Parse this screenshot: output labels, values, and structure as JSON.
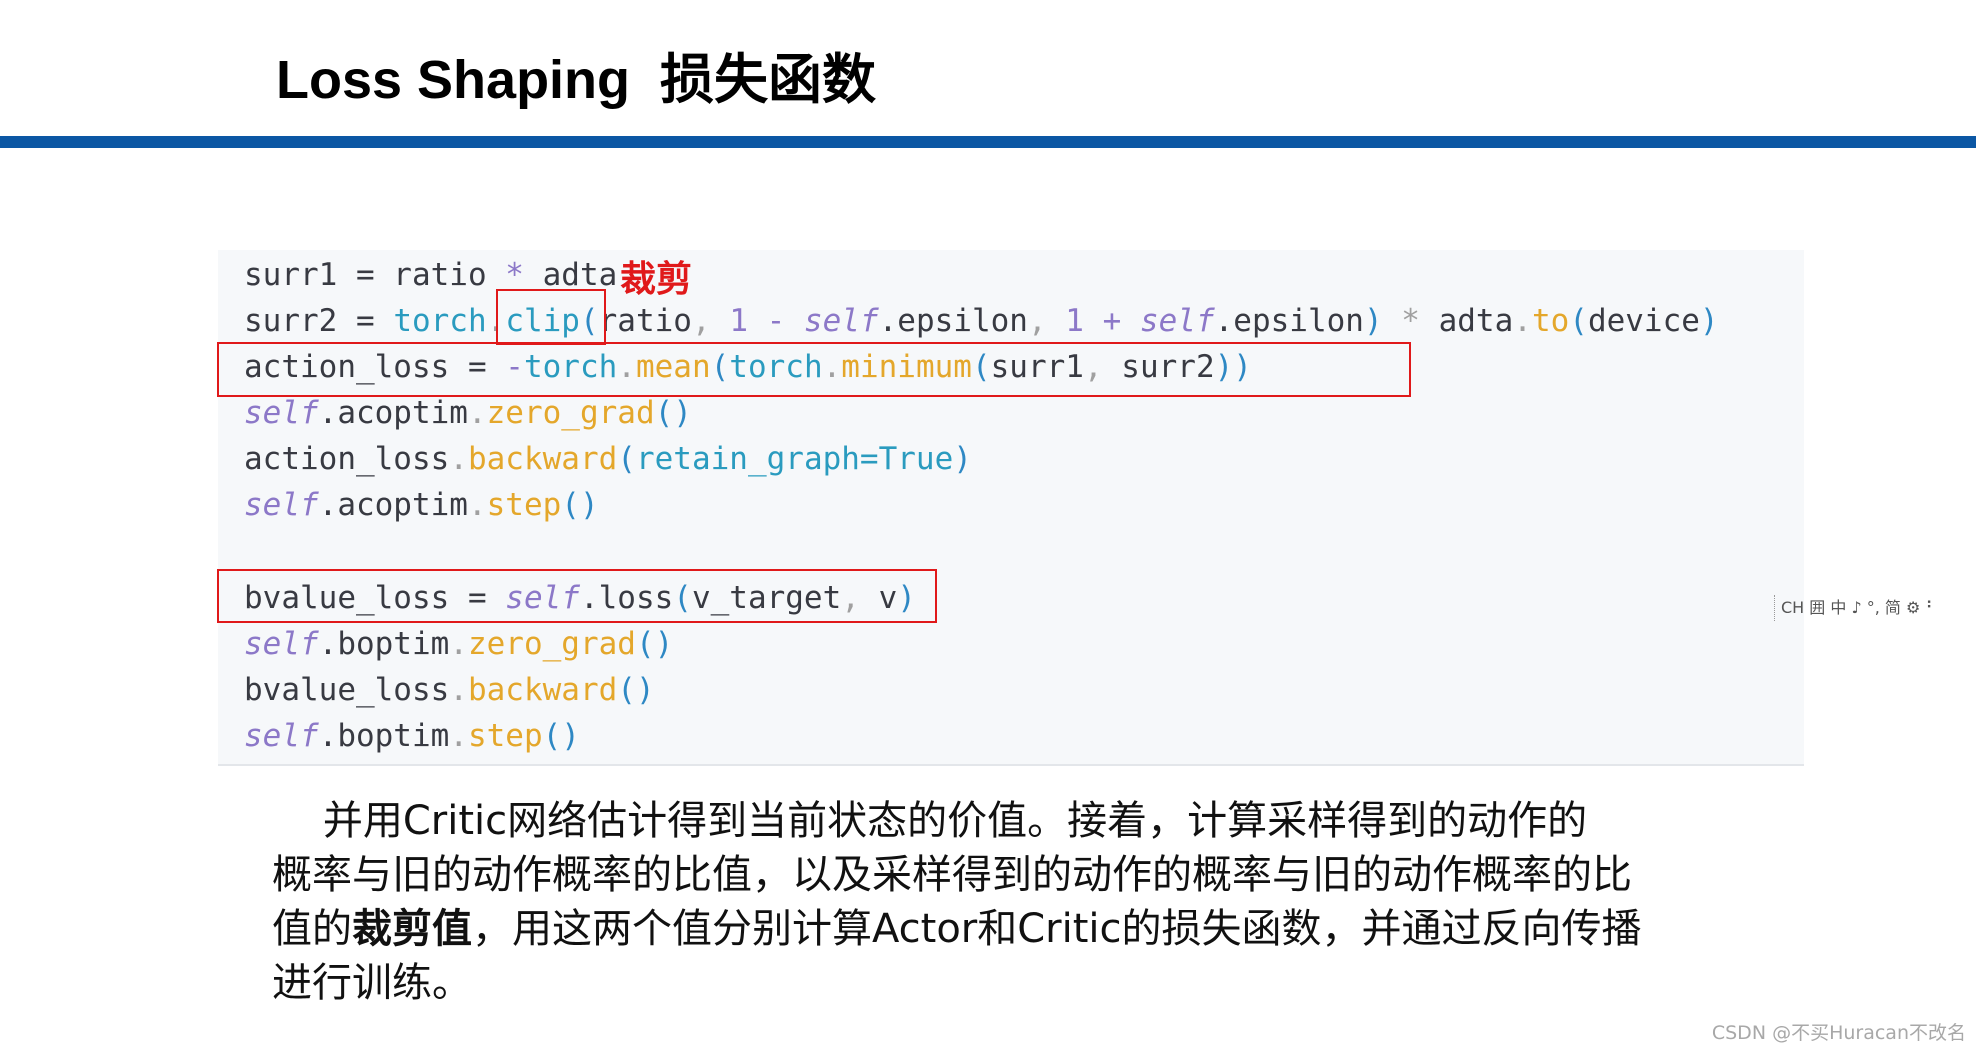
{
  "slide": {
    "title": "Loss Shaping  损失函数"
  },
  "code": {
    "line1": {
      "a": "surr1 = ratio ",
      "op": "*",
      "b": " adta"
    },
    "line2": {
      "a": "surr2 = ",
      "fn": "torch",
      "dot1": ".",
      "clip": "clip",
      "p1": "(",
      "b": "ratio",
      "c1": ",",
      "sp1": " ",
      "n1": "1",
      "op1": " - ",
      "self1": "self",
      "c": ".epsilon",
      "c2": ",",
      "sp2": " ",
      "n2": "1",
      "op2": " + ",
      "self2": "self",
      "d": ".epsilon",
      "p2": ")",
      "op3": " * ",
      "e": "adta",
      "dot2": ".",
      "to": "to",
      "p3": "(",
      "f": "device",
      "p4": ")"
    },
    "line3": {
      "a": "action_loss = ",
      "neg": "-",
      "fn1": "torch",
      "dot1": ".",
      "mean": "mean",
      "p1": "(",
      "fn2": "torch",
      "dot2": ".",
      "minimum": "minimum",
      "p2": "(",
      "b": "surr1",
      "c": ",",
      "d": " surr2",
      "p3": "))"
    },
    "line4": {
      "self": "self",
      "a": ".acoptim",
      "dot": ".",
      "m": "zero_grad",
      "p": "()"
    },
    "line5": {
      "a": "action_loss",
      "dot": ".",
      "m": "backward",
      "p1": "(",
      "b": "retain_graph=True",
      "p2": ")"
    },
    "line6": {
      "self": "self",
      "a": ".acoptim",
      "dot": ".",
      "m": "step",
      "p": "()"
    },
    "line7": {
      "a": "bvalue_loss = ",
      "self": "self",
      "b": ".loss",
      "p1": "(",
      "c": "v_target",
      "cm": ",",
      "d": " v",
      "p2": ")"
    },
    "line8": {
      "self": "self",
      "a": ".boptim",
      "dot": ".",
      "m": "zero_grad",
      "p": "()"
    },
    "line9": {
      "a": "bvalue_loss",
      "dot": ".",
      "m": "backward",
      "p": "()"
    },
    "line10": {
      "self": "self",
      "a": ".boptim",
      "dot": ".",
      "m": "step",
      "p": "()"
    }
  },
  "annotation": {
    "label": "裁剪"
  },
  "ime_toolbar": {
    "text": "CH 囲 中 ♪ °, 简 ⚙ ⠃"
  },
  "paragraph": {
    "line1": "    并用Critic网络估计得到当前状态的价值。接着，计算采样得到的动作的",
    "line2": "概率与旧的动作概率的比值，以及采样得到的动作的概率与旧的动作概率的比",
    "line3_a": "值的",
    "line3_emph": "裁剪值",
    "line3_b": "，用这两个值分别计算Actor和Critic的损失函数，并通过反向传播",
    "line4": "进行训练。"
  },
  "watermark": {
    "text": "CSDN @不买Huracan不改名"
  },
  "colors": {
    "title_bar": "#0b57a4",
    "highlight": "#e0191a",
    "code_bg": "#f6f8fa"
  }
}
